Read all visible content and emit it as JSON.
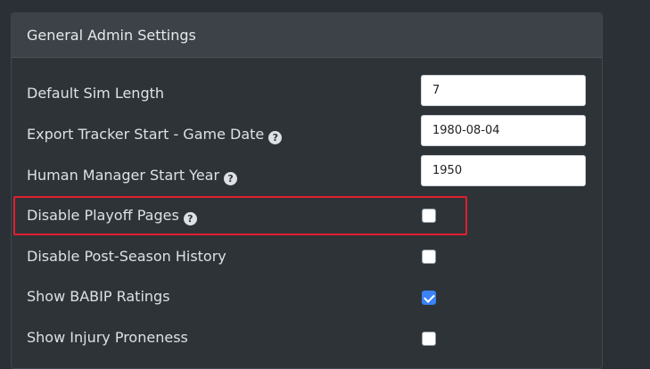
{
  "panel": {
    "title": "General Admin Settings"
  },
  "settings": [
    {
      "label": "Default Sim Length",
      "help": false,
      "type": "text",
      "value": "7"
    },
    {
      "label": "Export Tracker Start - Game Date",
      "help": true,
      "type": "text",
      "value": "1980-08-04"
    },
    {
      "label": "Human Manager Start Year",
      "help": true,
      "type": "text",
      "value": "1950"
    },
    {
      "label": "Disable Playoff Pages",
      "help": true,
      "type": "checkbox",
      "checked": false
    },
    {
      "label": "Disable Post-Season History",
      "help": false,
      "type": "checkbox",
      "checked": false
    },
    {
      "label": "Show BABIP Ratings",
      "help": false,
      "type": "checkbox",
      "checked": true
    },
    {
      "label": "Show Injury Proneness",
      "help": false,
      "type": "checkbox",
      "checked": false
    }
  ],
  "help_glyph": "?",
  "highlight_color": "#e0202d",
  "checkbox_checked_color": "#3b82f6"
}
